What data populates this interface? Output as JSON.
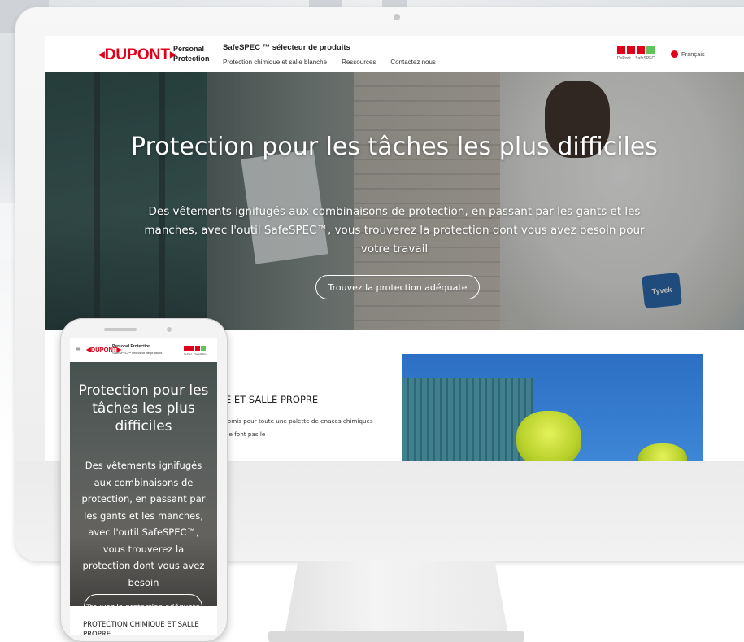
{
  "desktop": {
    "header": {
      "logo_text": "DUPONT",
      "brand_subtitle": "Personal Protection",
      "site_title": "SafeSPEC ™ sélecteur de produits",
      "nav": [
        "Protection chimique et salle blanche",
        "Ressources",
        "Contactez nous"
      ],
      "status_caption": "DuPont... SafeSPEC...",
      "language": "Français"
    },
    "hero": {
      "title": "Protection pour les tâches les plus difficiles",
      "text": "Des vêtements ignifugés aux combinaisons de protection, en passant par les gants et les manches, avec l'outil SafeSPEC™, vous trouverez la protection dont vous avez besoin pour votre travail",
      "cta_label": "Trouvez la protection adéquate",
      "badge_text": "Tyvek"
    },
    "section": {
      "title": "E ET SALLE PROPRE",
      "text": "romis pour toute une palette de enaces chimiques ne font pas le"
    }
  },
  "mobile": {
    "header": {
      "menu_icon": "≡",
      "logo_text": "DUPONT",
      "brand": "Personal Protection",
      "subtitle": "SafeSPEC™ sélecteur de produits",
      "status_caption": "DuPont... SafeSPEC..."
    },
    "hero": {
      "title": "Protection pour les tâches les plus difficiles",
      "text": "Des vêtements ignifugés aux combinaisons de protection, en passant par les gants et les manches, avec l'outil SafeSPEC™, vous trouverez la protection dont vous avez besoin",
      "cta_label": "Trouvez la protection adéquate"
    },
    "section_title": "PROTECTION CHIMIQUE ET SALLE PROPRE"
  },
  "colors": {
    "brand_red": "#e1001a",
    "status_green": "#61c15b",
    "tyvek_blue": "#1f5fa8"
  }
}
